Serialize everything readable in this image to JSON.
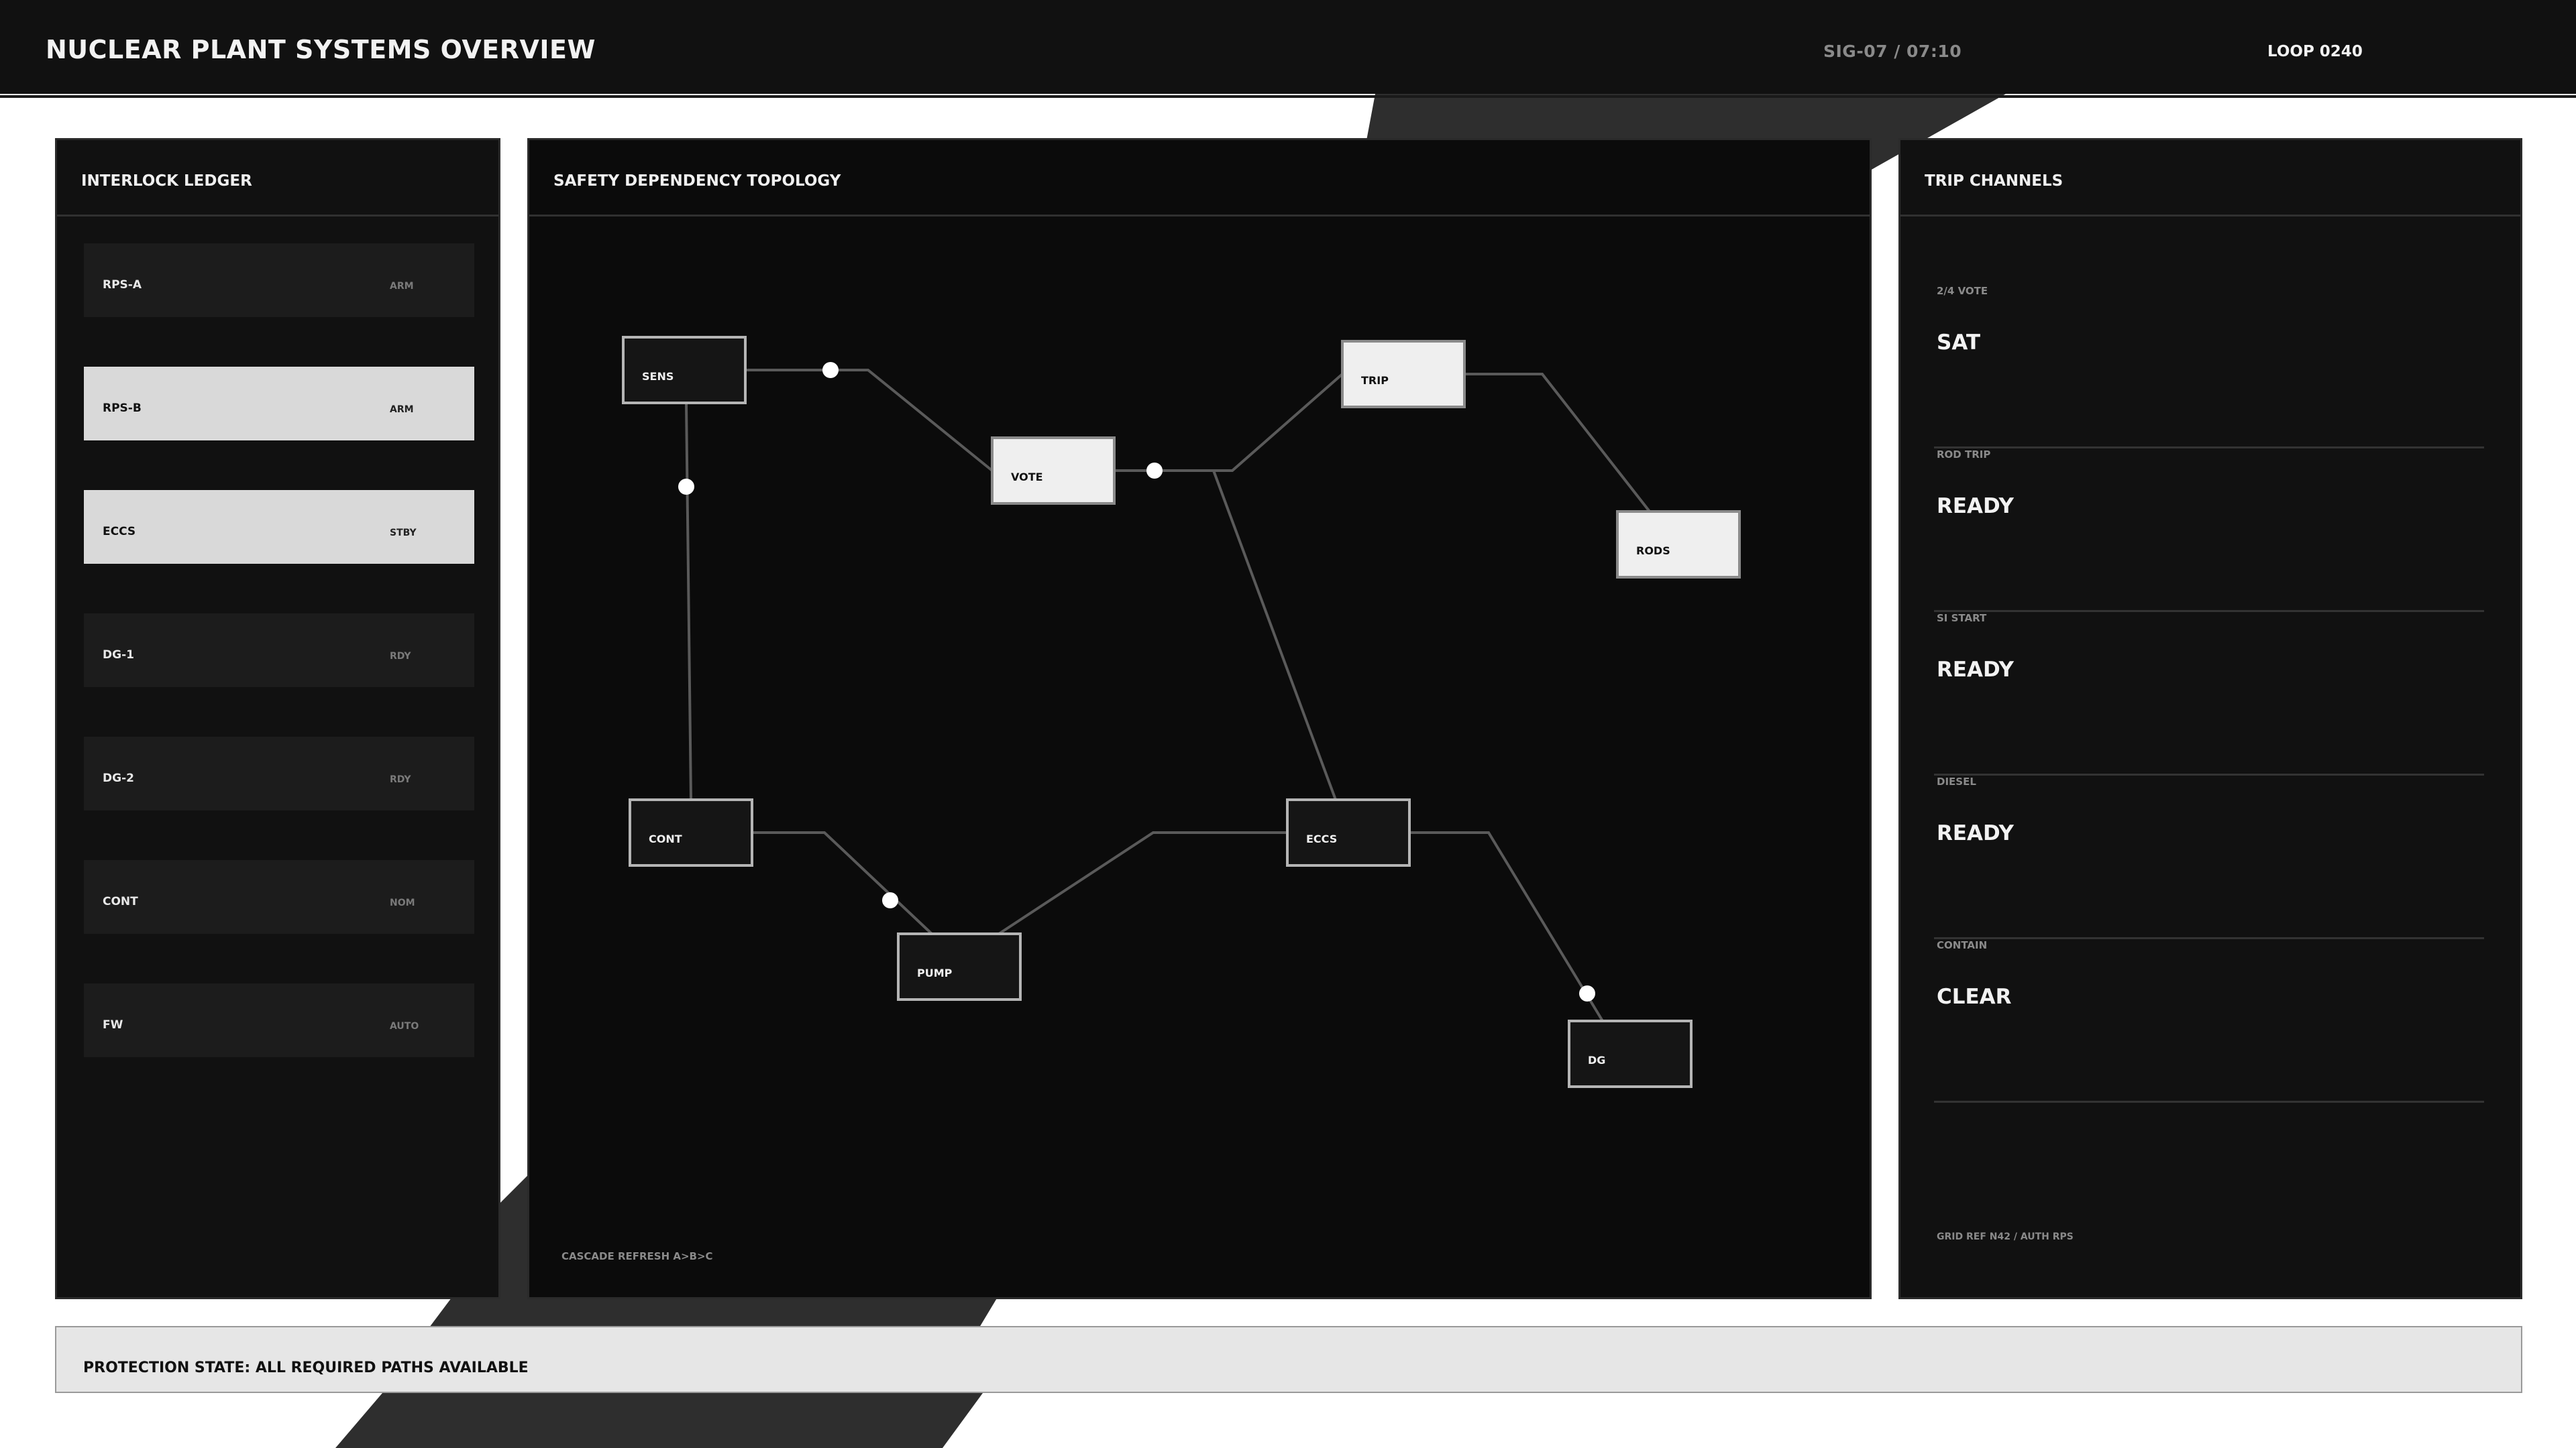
{
  "header": {
    "title": "NUCLEAR PLANT SYSTEMS OVERVIEW",
    "signal_time": "SIG-07 / 07:10",
    "loop": "LOOP 0240"
  },
  "ledger": {
    "title": "INTERLOCK LEDGER",
    "rows": [
      {
        "name": "RPS-A",
        "state": "ARM",
        "active": false
      },
      {
        "name": "RPS-B",
        "state": "ARM",
        "active": true
      },
      {
        "name": "ECCS",
        "state": "STBY",
        "active": true
      },
      {
        "name": "DG-1",
        "state": "RDY",
        "active": false
      },
      {
        "name": "DG-2",
        "state": "RDY",
        "active": false
      },
      {
        "name": "CONT",
        "state": "NOM",
        "active": false
      },
      {
        "name": "FW",
        "state": "AUTO",
        "active": false
      }
    ]
  },
  "topology": {
    "title": "SAFETY DEPENDENCY TOPOLOGY",
    "footer": "CASCADE REFRESH  A>B>C",
    "nodes": [
      {
        "id": "SENS",
        "label": "SENS",
        "highlight": false
      },
      {
        "id": "VOTE",
        "label": "VOTE",
        "highlight": true
      },
      {
        "id": "TRIP",
        "label": "TRIP",
        "highlight": true
      },
      {
        "id": "RODS",
        "label": "RODS",
        "highlight": true
      },
      {
        "id": "CONT",
        "label": "CONT",
        "highlight": false
      },
      {
        "id": "PUMP",
        "label": "PUMP",
        "highlight": false
      },
      {
        "id": "ECCS",
        "label": "ECCS",
        "highlight": false
      },
      {
        "id": "DG",
        "label": "DG",
        "highlight": false
      }
    ],
    "edges": [
      [
        "SENS",
        "VOTE"
      ],
      [
        "VOTE",
        "TRIP"
      ],
      [
        "TRIP",
        "RODS"
      ],
      [
        "VOTE",
        "ECCS"
      ],
      [
        "SENS",
        "CONT"
      ],
      [
        "CONT",
        "PUMP"
      ],
      [
        "PUMP",
        "ECCS"
      ],
      [
        "ECCS",
        "DG"
      ]
    ]
  },
  "trip_channels": {
    "title": "TRIP CHANNELS",
    "channels": [
      {
        "label": "2/4 VOTE",
        "value": "SAT"
      },
      {
        "label": "ROD TRIP",
        "value": "READY"
      },
      {
        "label": "SI START",
        "value": "READY"
      },
      {
        "label": "DIESEL",
        "value": "READY"
      },
      {
        "label": "CONTAIN",
        "value": "CLEAR"
      }
    ],
    "footer": "GRID REF N42 / AUTH RPS"
  },
  "status": {
    "text": "PROTECTION STATE: ALL REQUIRED PATHS AVAILABLE"
  },
  "colors": {
    "background": "#111111",
    "accent_light": "#d9d9d9",
    "line": "#5a5a5a"
  }
}
